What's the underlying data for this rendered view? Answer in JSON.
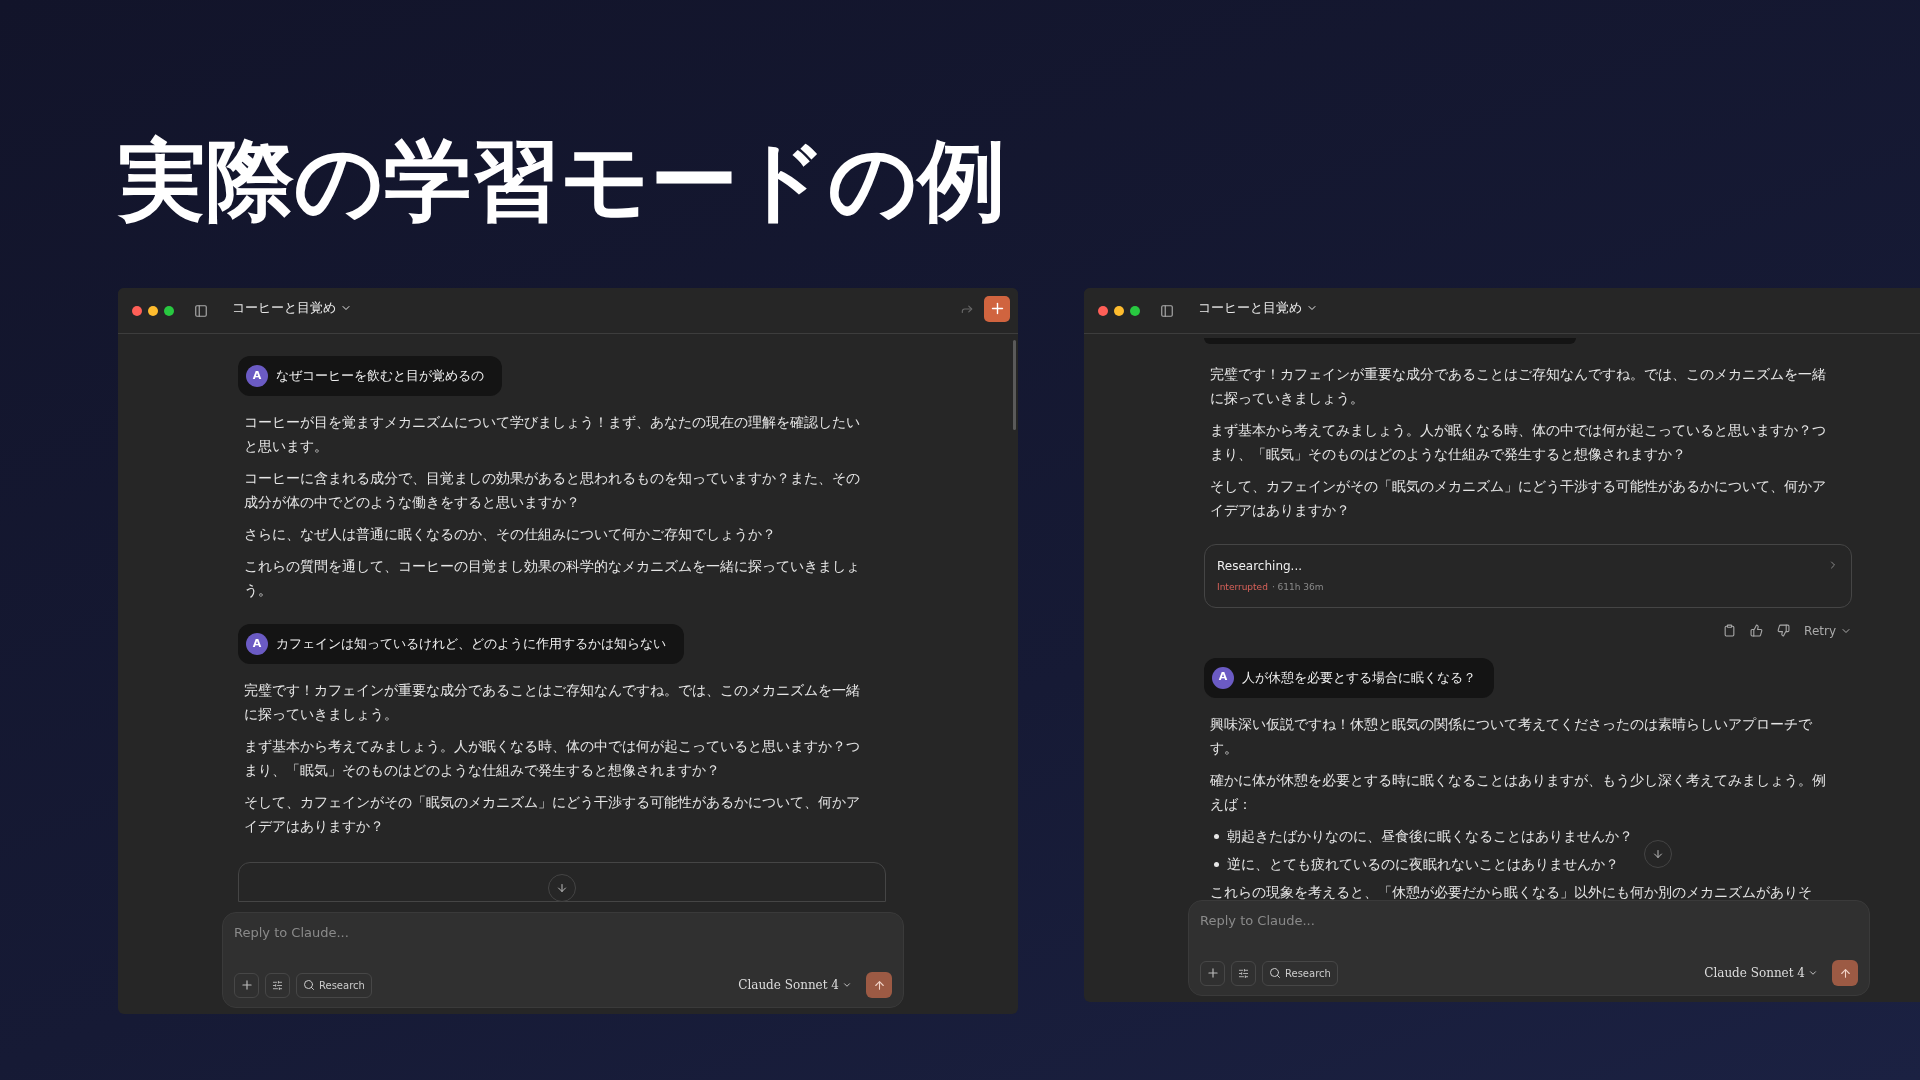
{
  "slide_title": "実際の学習モードの例",
  "windows": [
    {
      "title": "コーヒーと目覚め",
      "header_actions": true,
      "scrollbar": true,
      "messages": [
        {
          "kind": "user",
          "avatar": "A",
          "text": "なぜコーヒーを飲むと目が覚めるの"
        },
        {
          "kind": "assistant",
          "blocks": [
            {
              "kind": "paragraph",
              "text": "コーヒーが目を覚ますメカニズムについて学びましょう！まず、あなたの現在の理解を確認したいと思います。"
            },
            {
              "kind": "paragraph",
              "text": "コーヒーに含まれる成分で、目覚ましの効果があると思われるものを知っていますか？また、その成分が体の中でどのような働きをすると思いますか？"
            },
            {
              "kind": "paragraph",
              "text": "さらに、なぜ人は普通に眠くなるのか、その仕組みについて何かご存知でしょうか？"
            },
            {
              "kind": "paragraph",
              "text": "これらの質問を通して、コーヒーの目覚まし効果の科学的なメカニズムを一緒に探っていきましょう。"
            }
          ]
        },
        {
          "kind": "user",
          "avatar": "A",
          "text": "カフェインは知っているけれど、どのように作用するかは知らない"
        },
        {
          "kind": "assistant",
          "blocks": [
            {
              "kind": "paragraph",
              "text": "完璧です！カフェインが重要な成分であることはご存知なんですね。では、このメカニズムを一緒に探っていきましょう。"
            },
            {
              "kind": "paragraph",
              "text": "まず基本から考えてみましょう。人が眠くなる時、体の中では何が起こっていると思いますか？つまり、「眠気」そのものはどのような仕組みで発生すると想像されますか？"
            },
            {
              "kind": "paragraph",
              "text": "そして、カフェインがその「眠気のメカニズム」にどう干渉する可能性があるかについて、何かアイデアはありますか？"
            }
          ]
        },
        {
          "kind": "research_cut"
        }
      ],
      "composer": {
        "placeholder": "Reply to Claude...",
        "research_label": "Research",
        "model": "Claude Sonnet 4"
      }
    },
    {
      "title": "コーヒーと目覚め",
      "messages": [
        {
          "kind": "user_cut"
        },
        {
          "kind": "assistant",
          "blocks": [
            {
              "kind": "paragraph",
              "text": "完璧です！カフェインが重要な成分であることはご存知なんですね。では、このメカニズムを一緒に探っていきましょう。"
            },
            {
              "kind": "paragraph",
              "text": "まず基本から考えてみましょう。人が眠くなる時、体の中では何が起こっていると思いますか？つまり、「眠気」そのものはどのような仕組みで発生すると想像されますか？"
            },
            {
              "kind": "paragraph",
              "text": "そして、カフェインがその「眠気のメカニズム」にどう干渉する可能性があるかについて、何かアイデアはありますか？"
            }
          ]
        },
        {
          "kind": "research",
          "title": "Researching...",
          "status": "Interrupted",
          "elapsed": "· 611h 36m"
        },
        {
          "kind": "actions",
          "retry": "Retry"
        },
        {
          "kind": "user",
          "avatar": "A",
          "text": "人が休憩を必要とする場合に眠くなる？"
        },
        {
          "kind": "assistant",
          "blocks": [
            {
              "kind": "paragraph",
              "text": "興味深い仮説ですね！休憩と眠気の関係について考えてくださったのは素晴らしいアプローチです。"
            },
            {
              "kind": "paragraph",
              "text": "確かに体が休憩を必要とする時に眠くなることはありますが、もう少し深く考えてみましょう。例えば："
            },
            {
              "kind": "bullet",
              "text": "朝起きたばかりなのに、昼食後に眠くなることはありませんか？"
            },
            {
              "kind": "bullet",
              "text": "逆に、とても疲れているのに夜眠れないことはありませんか？"
            },
            {
              "kind": "paragraph_cut",
              "text": "これらの現象を考えると、「休憩が必要だから眠くなる」以外にも何か別のメカニズムがありそ"
            }
          ]
        }
      ],
      "composer": {
        "placeholder": "Reply to Claude...",
        "research_label": "Research",
        "model": "Claude Sonnet 4"
      }
    }
  ]
}
